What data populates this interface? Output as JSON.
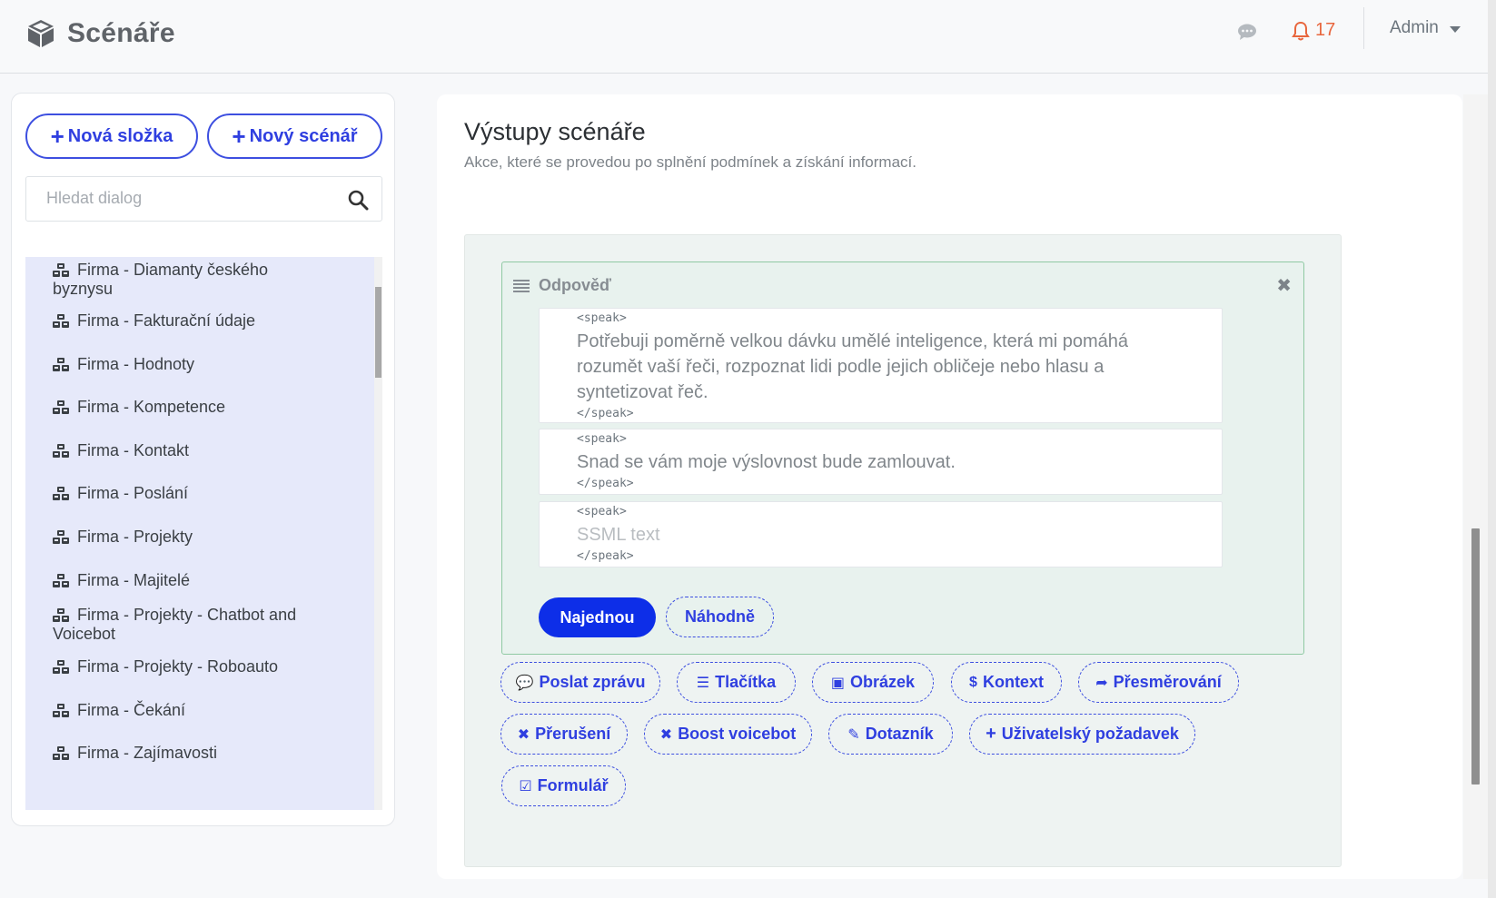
{
  "header": {
    "title": "Scénáře",
    "notifications_count": "17",
    "user": "Admin"
  },
  "sidebar": {
    "new_folder_label": "Nová složka",
    "new_scenario_label": "Nový scénář",
    "search_placeholder": "Hledat dialog",
    "items": [
      {
        "label": "Firma - Diamanty českého byznysu"
      },
      {
        "label": "Firma - Fakturační údaje"
      },
      {
        "label": "Firma - Hodnoty"
      },
      {
        "label": "Firma - Kompetence"
      },
      {
        "label": "Firma - Kontakt"
      },
      {
        "label": "Firma - Poslání"
      },
      {
        "label": "Firma - Projekty"
      },
      {
        "label": "Firma - Majitelé"
      },
      {
        "label": "Firma - Projekty - Chatbot and Voicebot"
      },
      {
        "label": "Firma - Projekty - Roboauto"
      },
      {
        "label": "Firma - Čekání"
      },
      {
        "label": "Firma - Zajímavosti"
      }
    ]
  },
  "main": {
    "title": "Výstupy scénáře",
    "subtitle": "Akce, které se provedou po splnění podmínek a získání informací.",
    "reply": {
      "heading": "Odpověď",
      "open_tag": "<speak>",
      "close_tag": "</speak>",
      "texts": [
        "Potřebuji poměrně velkou dávku umělé inteligence, která mi pomáhá rozumět vaší řeči, rozpoznat lidi podle jejich obličeje nebo hlasu a syntetizovat řeč.",
        "Snad se vám moje výslovnost bude zamlouvat."
      ],
      "placeholder": "SSML text",
      "mode_once": "Najednou",
      "mode_random": "Náhodně"
    },
    "actions": {
      "send_message": "Poslat zprávu",
      "buttons": "Tlačítka",
      "image": "Obrázek",
      "context": "Kontext",
      "redirect": "Přesměrování",
      "interrupt": "Přerušení",
      "boost_voicebot": "Boost voicebot",
      "questionnaire": "Dotazník",
      "user_request": "Uživatelský požadavek",
      "form": "Formulář"
    }
  },
  "colors": {
    "accent": "#2f3fe0",
    "solid_button": "#0d2ee8",
    "notification": "#e8663d",
    "tree_bg": "#e6e9fa",
    "reply_border": "#8fc9a3"
  }
}
